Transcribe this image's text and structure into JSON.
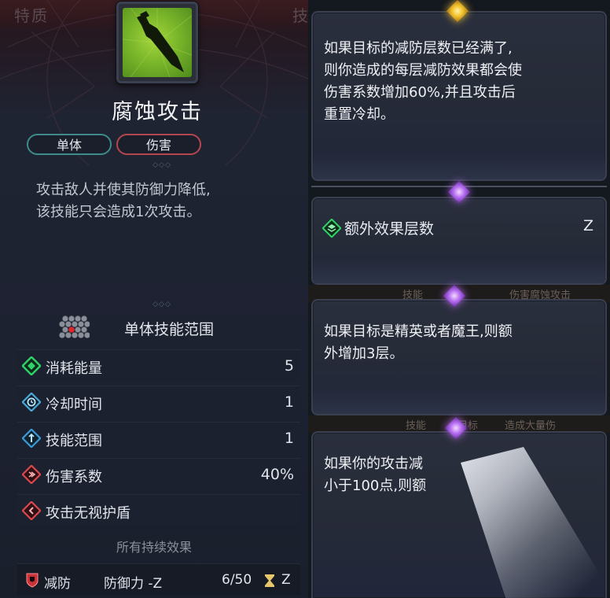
{
  "left_panel": {
    "ghost_left": "特质",
    "ghost_right": "技",
    "skill_name": "腐蚀攻击",
    "tags": [
      "单体",
      "伤害"
    ],
    "description": [
      "攻击敌人并使其防御力降低,",
      "该技能只会造成1次攻击。"
    ],
    "range_label": "单体技能范围",
    "stats": [
      {
        "label": "消耗能量",
        "value": "5",
        "icon": "energy-diamond-icon",
        "color": "#2fd36a"
      },
      {
        "label": "冷却时间",
        "value": "1",
        "icon": "cooldown-clock-icon",
        "color": "#4aa8d8"
      },
      {
        "label": "技能范围",
        "value": "1",
        "icon": "range-target-icon",
        "color": "#3a9ad6"
      },
      {
        "label": "伤害系数",
        "value": "40%",
        "icon": "damage-coefficient-icon",
        "color": "#d8484e"
      },
      {
        "label": "攻击无视护盾",
        "value": "",
        "icon": "ignore-shield-icon",
        "color": "#d8484e"
      }
    ],
    "effects_title": "所有持续效果",
    "effect": {
      "name": "减防",
      "stat": "防御力 -Z",
      "count": "6/50",
      "turns": "Z",
      "icon": "red-shield-icon"
    }
  },
  "tooltips": {
    "card1": [
      "如果目标的减防层数已经满了,",
      "则你造成的每层减防效果都会使",
      "伤害系数增加60%,并且攻击后",
      "重置冷却。"
    ],
    "card2": {
      "label": "额外效果层数",
      "value": "Z"
    },
    "card3": [
      "如果目标是精英或者魔王,则额",
      "外增加3层。"
    ],
    "card4": [
      "如果你的攻击减",
      "小于100点,则额"
    ],
    "strip1": [
      "技能",
      "伤害腐蚀攻击"
    ],
    "strip2": [
      "技能",
      "目标",
      "造成大量伤"
    ]
  }
}
